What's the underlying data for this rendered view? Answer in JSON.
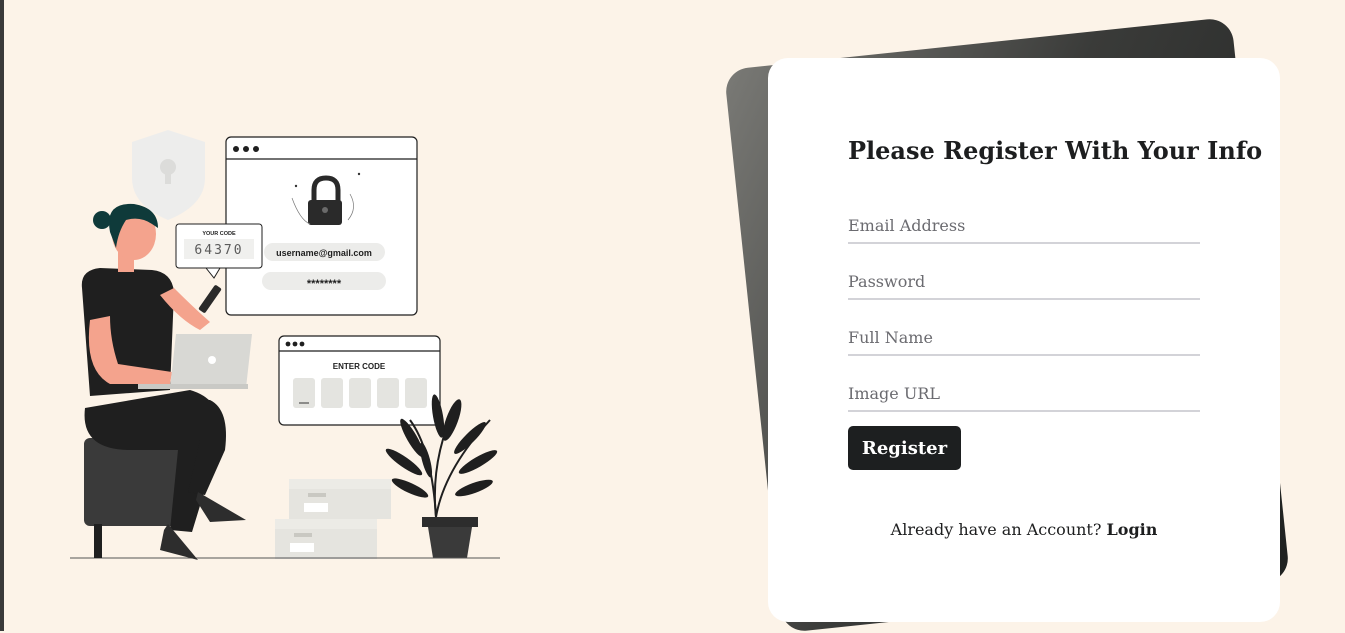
{
  "illustration": {
    "code_box_label": "YOUR CODE",
    "code_value": "64370",
    "username_text": "username@gmail.com",
    "password_text": "********",
    "enter_code_label": "ENTER CODE"
  },
  "form": {
    "title": "Please Register With Your Info",
    "email_placeholder": "Email Address",
    "password_placeholder": "Password",
    "fullname_placeholder": "Full Name",
    "imageurl_placeholder": "Image URL",
    "register_label": "Register",
    "login_prompt": "Already have an Account?",
    "login_link": "Login"
  },
  "colors": {
    "background": "#fcf3e8",
    "card": "#ffffff",
    "button": "#1d1f20",
    "text": "#1d1e1f"
  }
}
